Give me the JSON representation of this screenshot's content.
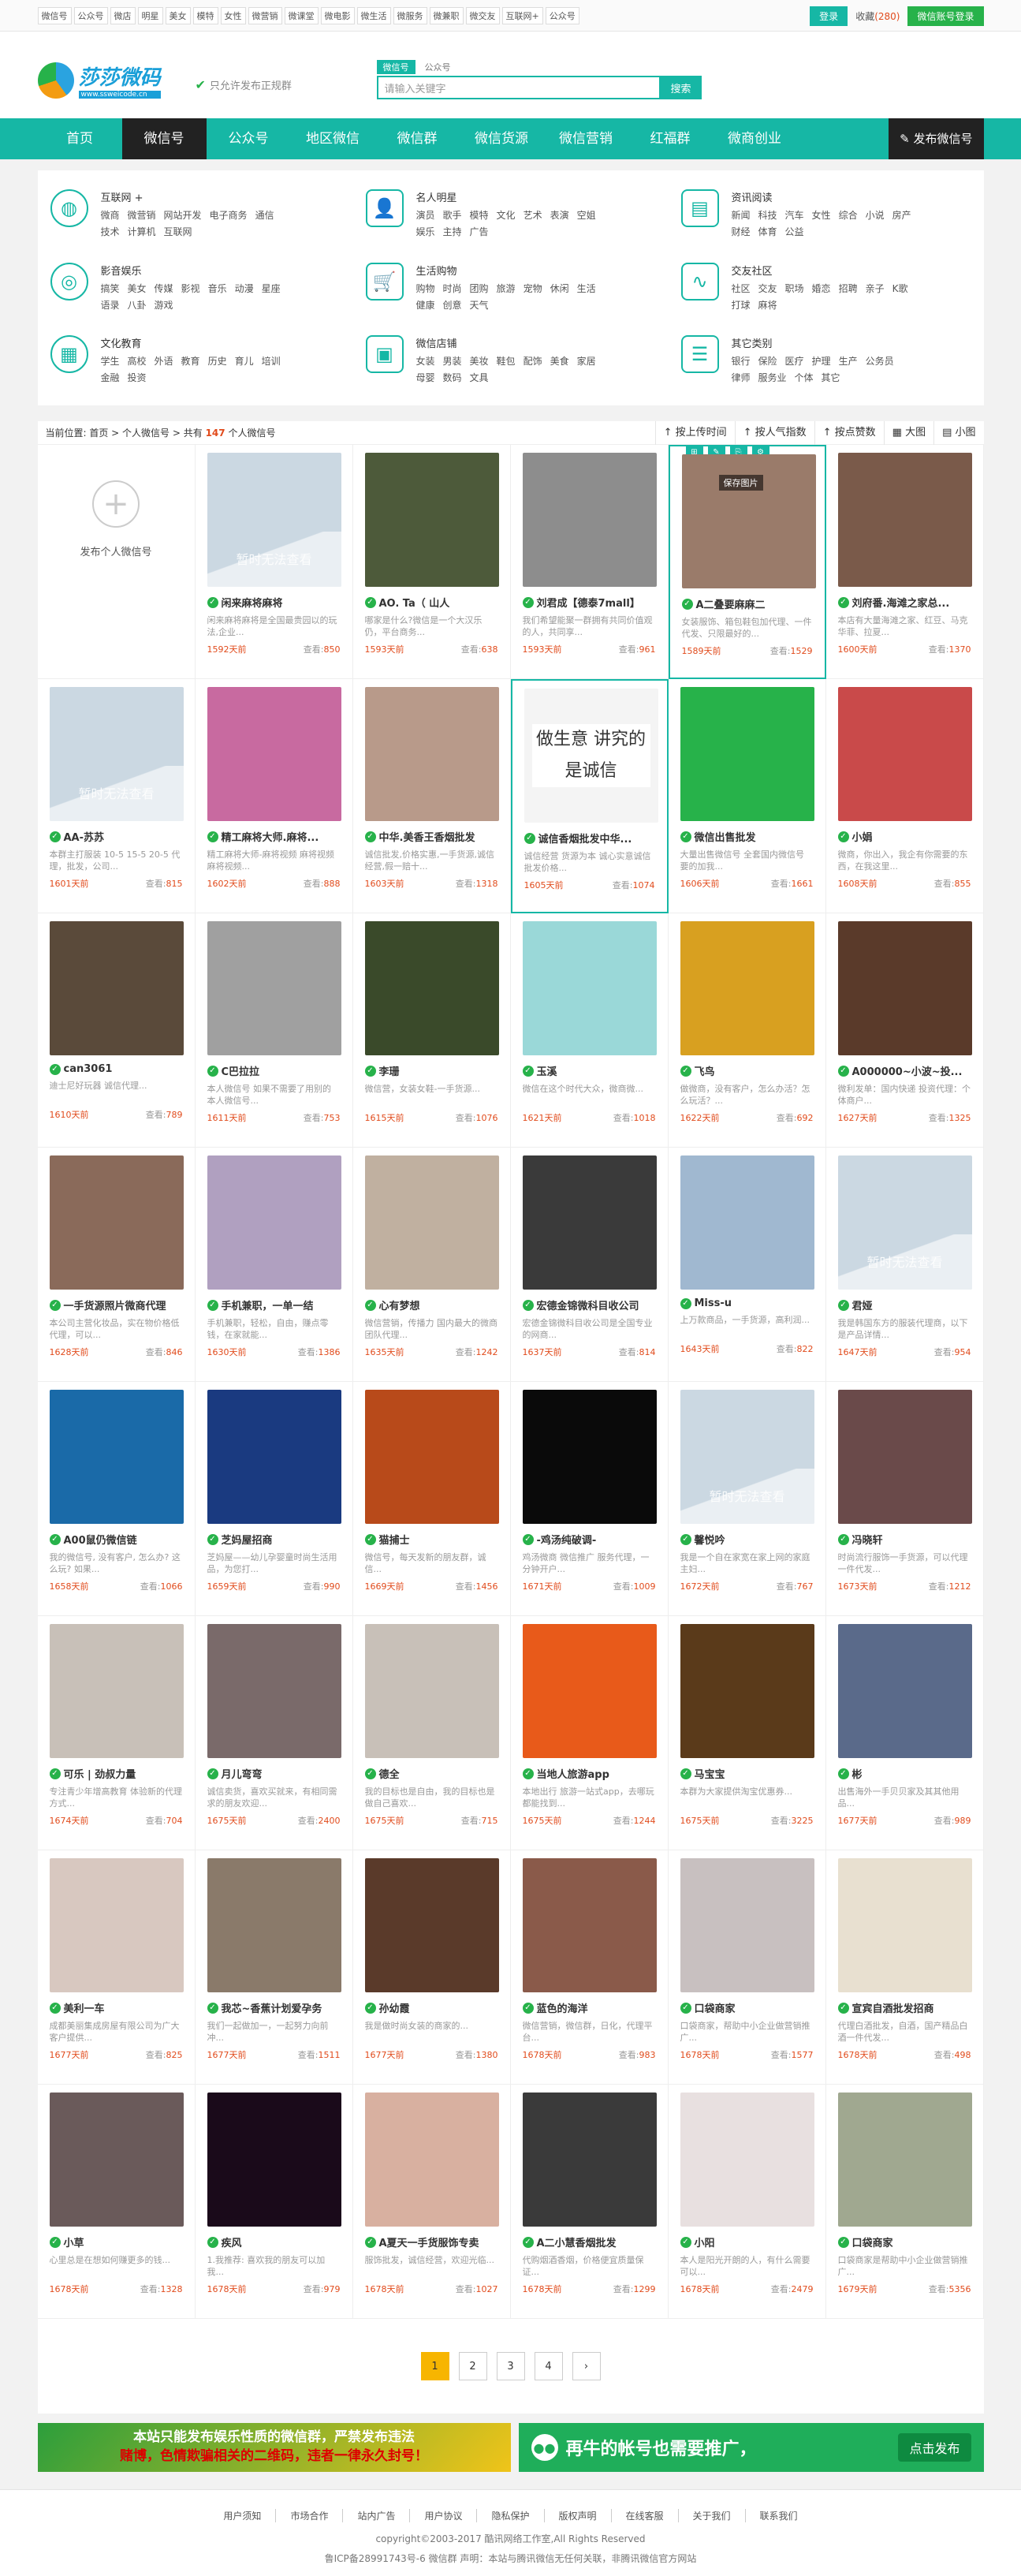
{
  "topbar": {
    "links": [
      "微信号",
      "公众号",
      "微店",
      "明星",
      "美女",
      "模特",
      "女性",
      "微营销",
      "微课堂",
      "微电影",
      "微生活",
      "微服务",
      "微兼职",
      "微交友",
      "互联网+",
      "公众号"
    ],
    "login": "登录",
    "fav_label": "收藏",
    "fav_count": "(280)",
    "wx_login": "微信账号登录"
  },
  "header": {
    "logo_name": "莎莎微码",
    "logo_sub": "www.ssweicode.cn",
    "slogan": "只允许发布正规群",
    "search_tabs": [
      "微信号",
      "公众号"
    ],
    "search_placeholder": "请输入关键字",
    "search_btn": "搜索"
  },
  "nav": {
    "items": [
      "首页",
      "微信号",
      "公众号",
      "地区微信",
      "微信群",
      "微信货源",
      "微信营销",
      "红福群",
      "微商创业"
    ],
    "publish": "发布微信号"
  },
  "categories": [
    {
      "title": "互联网 +",
      "links": [
        "微商",
        "微营销",
        "网站开发",
        "电子商务",
        "通信",
        "技术",
        "计算机",
        "互联网"
      ]
    },
    {
      "title": "名人明星",
      "links": [
        "演员",
        "歌手",
        "模特",
        "文化",
        "艺术",
        "表演",
        "空姐",
        "娱乐",
        "主持",
        "广告"
      ]
    },
    {
      "title": "资讯阅读",
      "links": [
        "新闻",
        "科技",
        "汽车",
        "女性",
        "综合",
        "小说",
        "房产",
        "财经",
        "体育",
        "公益"
      ]
    },
    {
      "title": "影音娱乐",
      "links": [
        "搞笑",
        "美女",
        "传媒",
        "影视",
        "音乐",
        "动漫",
        "星座",
        "语录",
        "八卦",
        "游戏"
      ]
    },
    {
      "title": "生活购物",
      "links": [
        "购物",
        "时尚",
        "团购",
        "旅游",
        "宠物",
        "休闲",
        "生活",
        "健康",
        "创意",
        "天气"
      ]
    },
    {
      "title": "交友社区",
      "links": [
        "社区",
        "交友",
        "职场",
        "婚恋",
        "招聘",
        "亲子",
        "K歌",
        "打球",
        "麻将"
      ]
    },
    {
      "title": "文化教育",
      "links": [
        "学生",
        "高校",
        "外语",
        "教育",
        "历史",
        "育儿",
        "培训",
        "金融",
        "投资"
      ]
    },
    {
      "title": "微信店铺",
      "links": [
        "女装",
        "男装",
        "美妆",
        "鞋包",
        "配饰",
        "美食",
        "家居",
        "母婴",
        "数码",
        "文具"
      ]
    },
    {
      "title": "其它类别",
      "links": [
        "银行",
        "保险",
        "医疗",
        "护理",
        "生产",
        "公务员",
        "律师",
        "服务业",
        "个体",
        "其它"
      ]
    }
  ],
  "crumb": {
    "prefix": "当前位置: 首页 > 个人微信号 > 共有",
    "count": "147",
    "suffix": "个人微信号",
    "sorts": [
      "↑ 按上传时间",
      "↑ 按人气指数",
      "↑ 按点赞数",
      "▦ 大图",
      "▤ 小图"
    ]
  },
  "add_card": {
    "label": "发布个人微信号"
  },
  "hl_tools": {
    "save_pic": "保存图片"
  },
  "view_label": "查看:",
  "cards": [
    {
      "name": "闲来麻将麻将",
      "desc": "闲来麻将麻将是全国最贵园以的玩法,企业...",
      "days": "1592天前",
      "views": "850",
      "bg": "#cbd8e2",
      "noimg": true
    },
    {
      "name": "AO. Ta（ 山人",
      "desc": "哪家是什么?微信是一个大汉乐仍，平台商务...",
      "days": "1593天前",
      "views": "638",
      "bg": "#4d5a3a"
    },
    {
      "name": "刘君成【德泰7mall】",
      "desc": "我们希望能聚一群拥有共同价值观的人，共同享...",
      "days": "1593天前",
      "views": "961",
      "bg": "#8d8d8d"
    },
    {
      "name": "A二叠要麻麻二",
      "desc": "女装服饰、箱包鞋包加代理、一件代发、只限最好的...",
      "days": "1589天前",
      "views": "1529",
      "bg": "#9a7b6a",
      "hl": true
    },
    {
      "name": "刘府番.海滩之家总...",
      "desc": "本店有大量海滩之家、红豆、马克华菲、拉夏...",
      "days": "1600天前",
      "views": "1370",
      "bg": "#7a5a4a"
    },
    {
      "name": "AA-苏苏",
      "desc": "本群主打服装 10-5 15-5 20-5 代理，批发，公司...",
      "days": "1601天前",
      "views": "815",
      "bg": "#cbd8e2",
      "noimg": true
    },
    {
      "name": "精工麻将大师.麻将...",
      "desc": "精工麻将大师-麻将视频 麻将视频 麻将视频...",
      "days": "1602天前",
      "views": "888",
      "bg": "#c86aa0"
    },
    {
      "name": "中华.美香王香烟批发",
      "desc": "诚信批发,价格实惠,一手货源,诚信经营,假一赔十...",
      "days": "1603天前",
      "views": "1318",
      "bg": "#b89a8a"
    },
    {
      "name": "诚信香烟批发中华...",
      "desc": "诚信经营 货源为本 诚心实意诚信批发价格...",
      "days": "1605天前",
      "views": "1074",
      "bg": "#f4f4f4",
      "caption": "做生意 讲究的是诚信",
      "hl": true
    },
    {
      "name": "微信出售批发",
      "desc": "大量出售微信号 全套国内微信号 要的加我...",
      "days": "1606天前",
      "views": "1661",
      "bg": "#27b24a"
    },
    {
      "name": "小娟",
      "desc": "微商，你出入，我企有你需要的东西，在我这里...",
      "days": "1608天前",
      "views": "855",
      "bg": "#c94a4a"
    },
    {
      "name": "can3061",
      "desc": "迪士尼好玩器 诚信代理...",
      "days": "1610天前",
      "views": "789",
      "bg": "#5a4a3a"
    },
    {
      "name": "C巴拉拉",
      "desc": "本人微信号 如果不需要了用别的 本人微信号...",
      "days": "1611天前",
      "views": "753",
      "bg": "#a0a0a0"
    },
    {
      "name": "李珊",
      "desc": "微信营，女装女鞋-一手货源...",
      "days": "1615天前",
      "views": "1076",
      "bg": "#3a4a2a"
    },
    {
      "name": "玉溪",
      "desc": "微信在这个时代大众，微商微...",
      "days": "1621天前",
      "views": "1018",
      "bg": "#9ad8d8"
    },
    {
      "name": "飞鸟",
      "desc": "做微商，没有客户，怎么办活？怎么玩活？...",
      "days": "1622天前",
      "views": "692",
      "bg": "#d8a020"
    },
    {
      "name": "A000000~小波~投...",
      "desc": "微利发单：国内快递 投资代理：个体商户...",
      "days": "1627天前",
      "views": "1325",
      "bg": "#5a3a2a"
    },
    {
      "name": "一手货源照片微商代理",
      "desc": "本公司主营化妆品，实在物价格低代理，可以...",
      "days": "1628天前",
      "views": "846",
      "bg": "#8a6a5a"
    },
    {
      "name": "手机兼职，一单一结",
      "desc": "手机兼职，轻松，自由，赚点零钱，在家就能...",
      "days": "1630天前",
      "views": "1386",
      "bg": "#b0a0c0"
    },
    {
      "name": "心有梦想",
      "desc": "微信营销，传播力 国内最大的微商团队代理...",
      "days": "1635天前",
      "views": "1242",
      "bg": "#c0b0a0"
    },
    {
      "name": "宏德金锦微科目收公司",
      "desc": "宏德金锦微科目收公司是全国专业的网商...",
      "days": "1637天前",
      "views": "814",
      "bg": "#3a3a3a"
    },
    {
      "name": "Miss-u",
      "desc": "上万款商品，一手货源，高利润...",
      "days": "1643天前",
      "views": "822",
      "bg": "#a0b8d0"
    },
    {
      "name": "君娅",
      "desc": "我是韩国东方的服装代理商，以下是产品详情...",
      "days": "1647天前",
      "views": "954",
      "bg": "#cbd8e2",
      "noimg": true
    },
    {
      "name": "A00鼠仍微信链",
      "desc": "我的微信号, 没有客户, 怎么办? 这么玩? 如果...",
      "days": "1658天前",
      "views": "1066",
      "bg": "#1a6aa8"
    },
    {
      "name": "芝妈屋招商",
      "desc": "芝妈屋——幼儿孕婴童时尚生活用品，为您打...",
      "days": "1659天前",
      "views": "990",
      "bg": "#1a3a80"
    },
    {
      "name": "猫捕士",
      "desc": "微信号，每天发新的朋友群，诚信...",
      "days": "1669天前",
      "views": "1456",
      "bg": "#b84a1a"
    },
    {
      "name": "-鸡汤纯破调-",
      "desc": "鸡汤微商 微信推广 服务代理，一分钟开户...",
      "days": "1671天前",
      "views": "1009",
      "bg": "#0a0a0a"
    },
    {
      "name": "馨悦吟",
      "desc": "我是一个自在家宽在家上网的家庭主妇...",
      "days": "1672天前",
      "views": "767",
      "bg": "#cbd8e2",
      "noimg": true
    },
    {
      "name": "冯晓轩",
      "desc": "时尚流行服饰一手货源，可以代理一件代发...",
      "days": "1673天前",
      "views": "1212",
      "bg": "#6a4a4a"
    },
    {
      "name": "可乐 | 劲叔力量",
      "desc": "专注青少年增高教育 体验新的代理方式...",
      "days": "1674天前",
      "views": "704",
      "bg": "#c8c0b8"
    },
    {
      "name": "月儿弯弯",
      "desc": "诚信卖货，喜欢买就来，有相同需求的朋友欢迎...",
      "days": "1675天前",
      "views": "2400",
      "bg": "#7a6a6a"
    },
    {
      "name": "德全",
      "desc": "我的目标也是自由，我的目标也是做自己喜欢...",
      "days": "1675天前",
      "views": "715",
      "bg": "#c8c0b8"
    },
    {
      "name": "当地人旅游app",
      "desc": "本地出行 旅游一站式app，去哪玩都能找到...",
      "days": "1675天前",
      "views": "1244",
      "bg": "#e85a1a"
    },
    {
      "name": "马宝宝",
      "desc": "本群为大家提供淘宝优惠券...",
      "days": "1675天前",
      "views": "3225",
      "bg": "#5a3a1a"
    },
    {
      "name": "彬",
      "desc": "出售海外一手贝贝家及其其他用品...",
      "days": "1677天前",
      "views": "989",
      "bg": "#5a6a8a"
    },
    {
      "name": "美利一车",
      "desc": "成都美丽集成房屋有限公司为广大客户提供...",
      "days": "1677天前",
      "views": "825",
      "bg": "#d8c8c0"
    },
    {
      "name": "我芯~香蕉计划爱孕务",
      "desc": "我们一起做加一，一起努力向前冲...",
      "days": "1677天前",
      "views": "1511",
      "bg": "#8a7a6a"
    },
    {
      "name": "孙幼霞",
      "desc": "我是做时尚女装的商家的...",
      "days": "1677天前",
      "views": "1380",
      "bg": "#5a3a2a"
    },
    {
      "name": "蓝色的海洋",
      "desc": "微信营销，微信群，日化，代理平台...",
      "days": "1678天前",
      "views": "983",
      "bg": "#8a5a4a"
    },
    {
      "name": "口袋商家",
      "desc": "口袋商家，帮助中小企业做营销推广...",
      "days": "1678天前",
      "views": "1577",
      "bg": "#c8c0c0"
    },
    {
      "name": "宣宾自酒批发招商",
      "desc": "代理白酒批发，自酒，国产精品白酒一件代发...",
      "days": "1678天前",
      "views": "498",
      "bg": "#e8e0d0"
    },
    {
      "name": "小草",
      "desc": "心里总是在想如何赚更多的钱...",
      "days": "1678天前",
      "views": "1328",
      "bg": "#6a5a5a"
    },
    {
      "name": "疾风",
      "desc": "1.我推荐: 喜欢我的朋友可以加我...",
      "days": "1678天前",
      "views": "979",
      "bg": "#1a0a1a"
    },
    {
      "name": "A夏天一手货服饰专卖",
      "desc": "服饰批发，诚信经营，欢迎光临...",
      "days": "1678天前",
      "views": "1027",
      "bg": "#d8b0a0"
    },
    {
      "name": "A二小慧香烟批发",
      "desc": "代购烟酒香烟，价格便宜质量保证...",
      "days": "1678天前",
      "views": "1299",
      "bg": "#3a3a3a"
    },
    {
      "name": "小阳",
      "desc": "本人是阳光开朗的人，有什么需要可以...",
      "days": "1678天前",
      "views": "2479",
      "bg": "#e8e0e0"
    },
    {
      "name": "口袋商家",
      "desc": "口袋商家是帮助中小企业做营销推广...",
      "days": "1679天前",
      "views": "5356",
      "bg": "#a0a890"
    }
  ],
  "pager": {
    "pages": [
      "1",
      "2",
      "3",
      "4"
    ],
    "next": "›"
  },
  "banner1": {
    "line1": "本站只能发布娱乐性质的微信群，严禁发布违法",
    "line2": "赌博，色情欺骗相关的二维码，违者一律永久封号！"
  },
  "banner2": {
    "text": "再牛的帐号也需要推广，",
    "btn": "点击发布"
  },
  "footer": {
    "links": [
      "用户须知",
      "市场合作",
      "站内广告",
      "用户协议",
      "隐私保护",
      "版权声明",
      "在线客服",
      "关于我们",
      "联系我们"
    ],
    "copyright": "copyright©2003-2017 酷讯网络工作室,All Rights Reserved",
    "icp": "鲁ICP备28991743号-6 微信群 声明：本站与腾讯微信无任何关联，非腾讯微信官方网站"
  }
}
